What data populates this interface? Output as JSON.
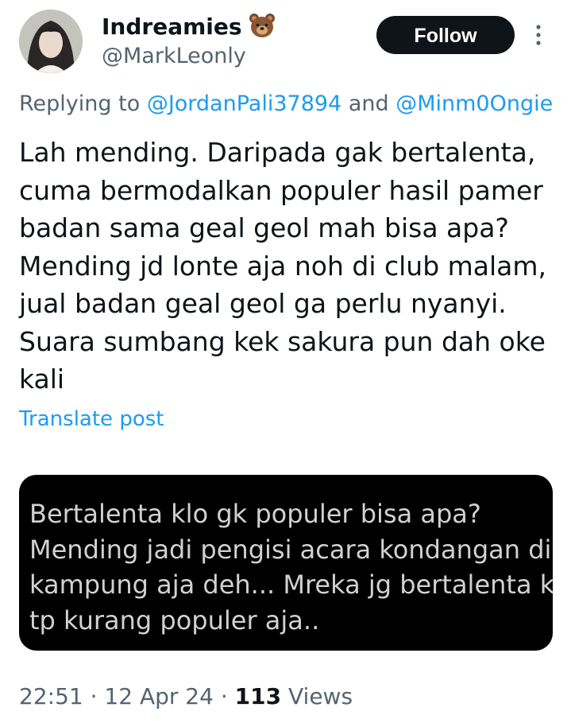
{
  "author": {
    "display_name": "Indreamies",
    "emoji_icon": "bear-face-icon",
    "handle": "@MarkLeonly"
  },
  "actions": {
    "follow_label": "Follow",
    "more_icon": "more-vertical-icon"
  },
  "reply_context": {
    "prefix": "Replying to",
    "mention_1": "@JordanPali37894",
    "conjunction": "and",
    "mention_2": "@Minm0Ongie"
  },
  "tweet": {
    "lines": [
      "Lah mending. Daripada gak bertalenta,",
      "cuma bermodalkan populer hasil pamer",
      "badan sama geal geol mah bisa apa?",
      "Mending jd lonte aja noh di club malam,",
      "jual badan geal geol ga perlu nyanyi.",
      "Suara sumbang kek sakura pun dah oke",
      "kali"
    ],
    "translate_label": "Translate post"
  },
  "attached_image": {
    "lines": [
      "Bertalenta klo gk populer bisa apa?",
      "Mending jadi pengisi acara kondangan di",
      "kampung aja deh... Mreka jg bertalenta kok,",
      "tp kurang populer aja.."
    ]
  },
  "meta": {
    "time": "22:51",
    "separator_1": "·",
    "date": "12 Apr 24",
    "separator_2": "·",
    "views_count": "113",
    "views_label": "Views"
  },
  "colors": {
    "text": "#0f1419",
    "secondary": "#536471",
    "link": "#1d9bf0",
    "button_bg": "#0f1419",
    "image_bg": "#000000"
  }
}
